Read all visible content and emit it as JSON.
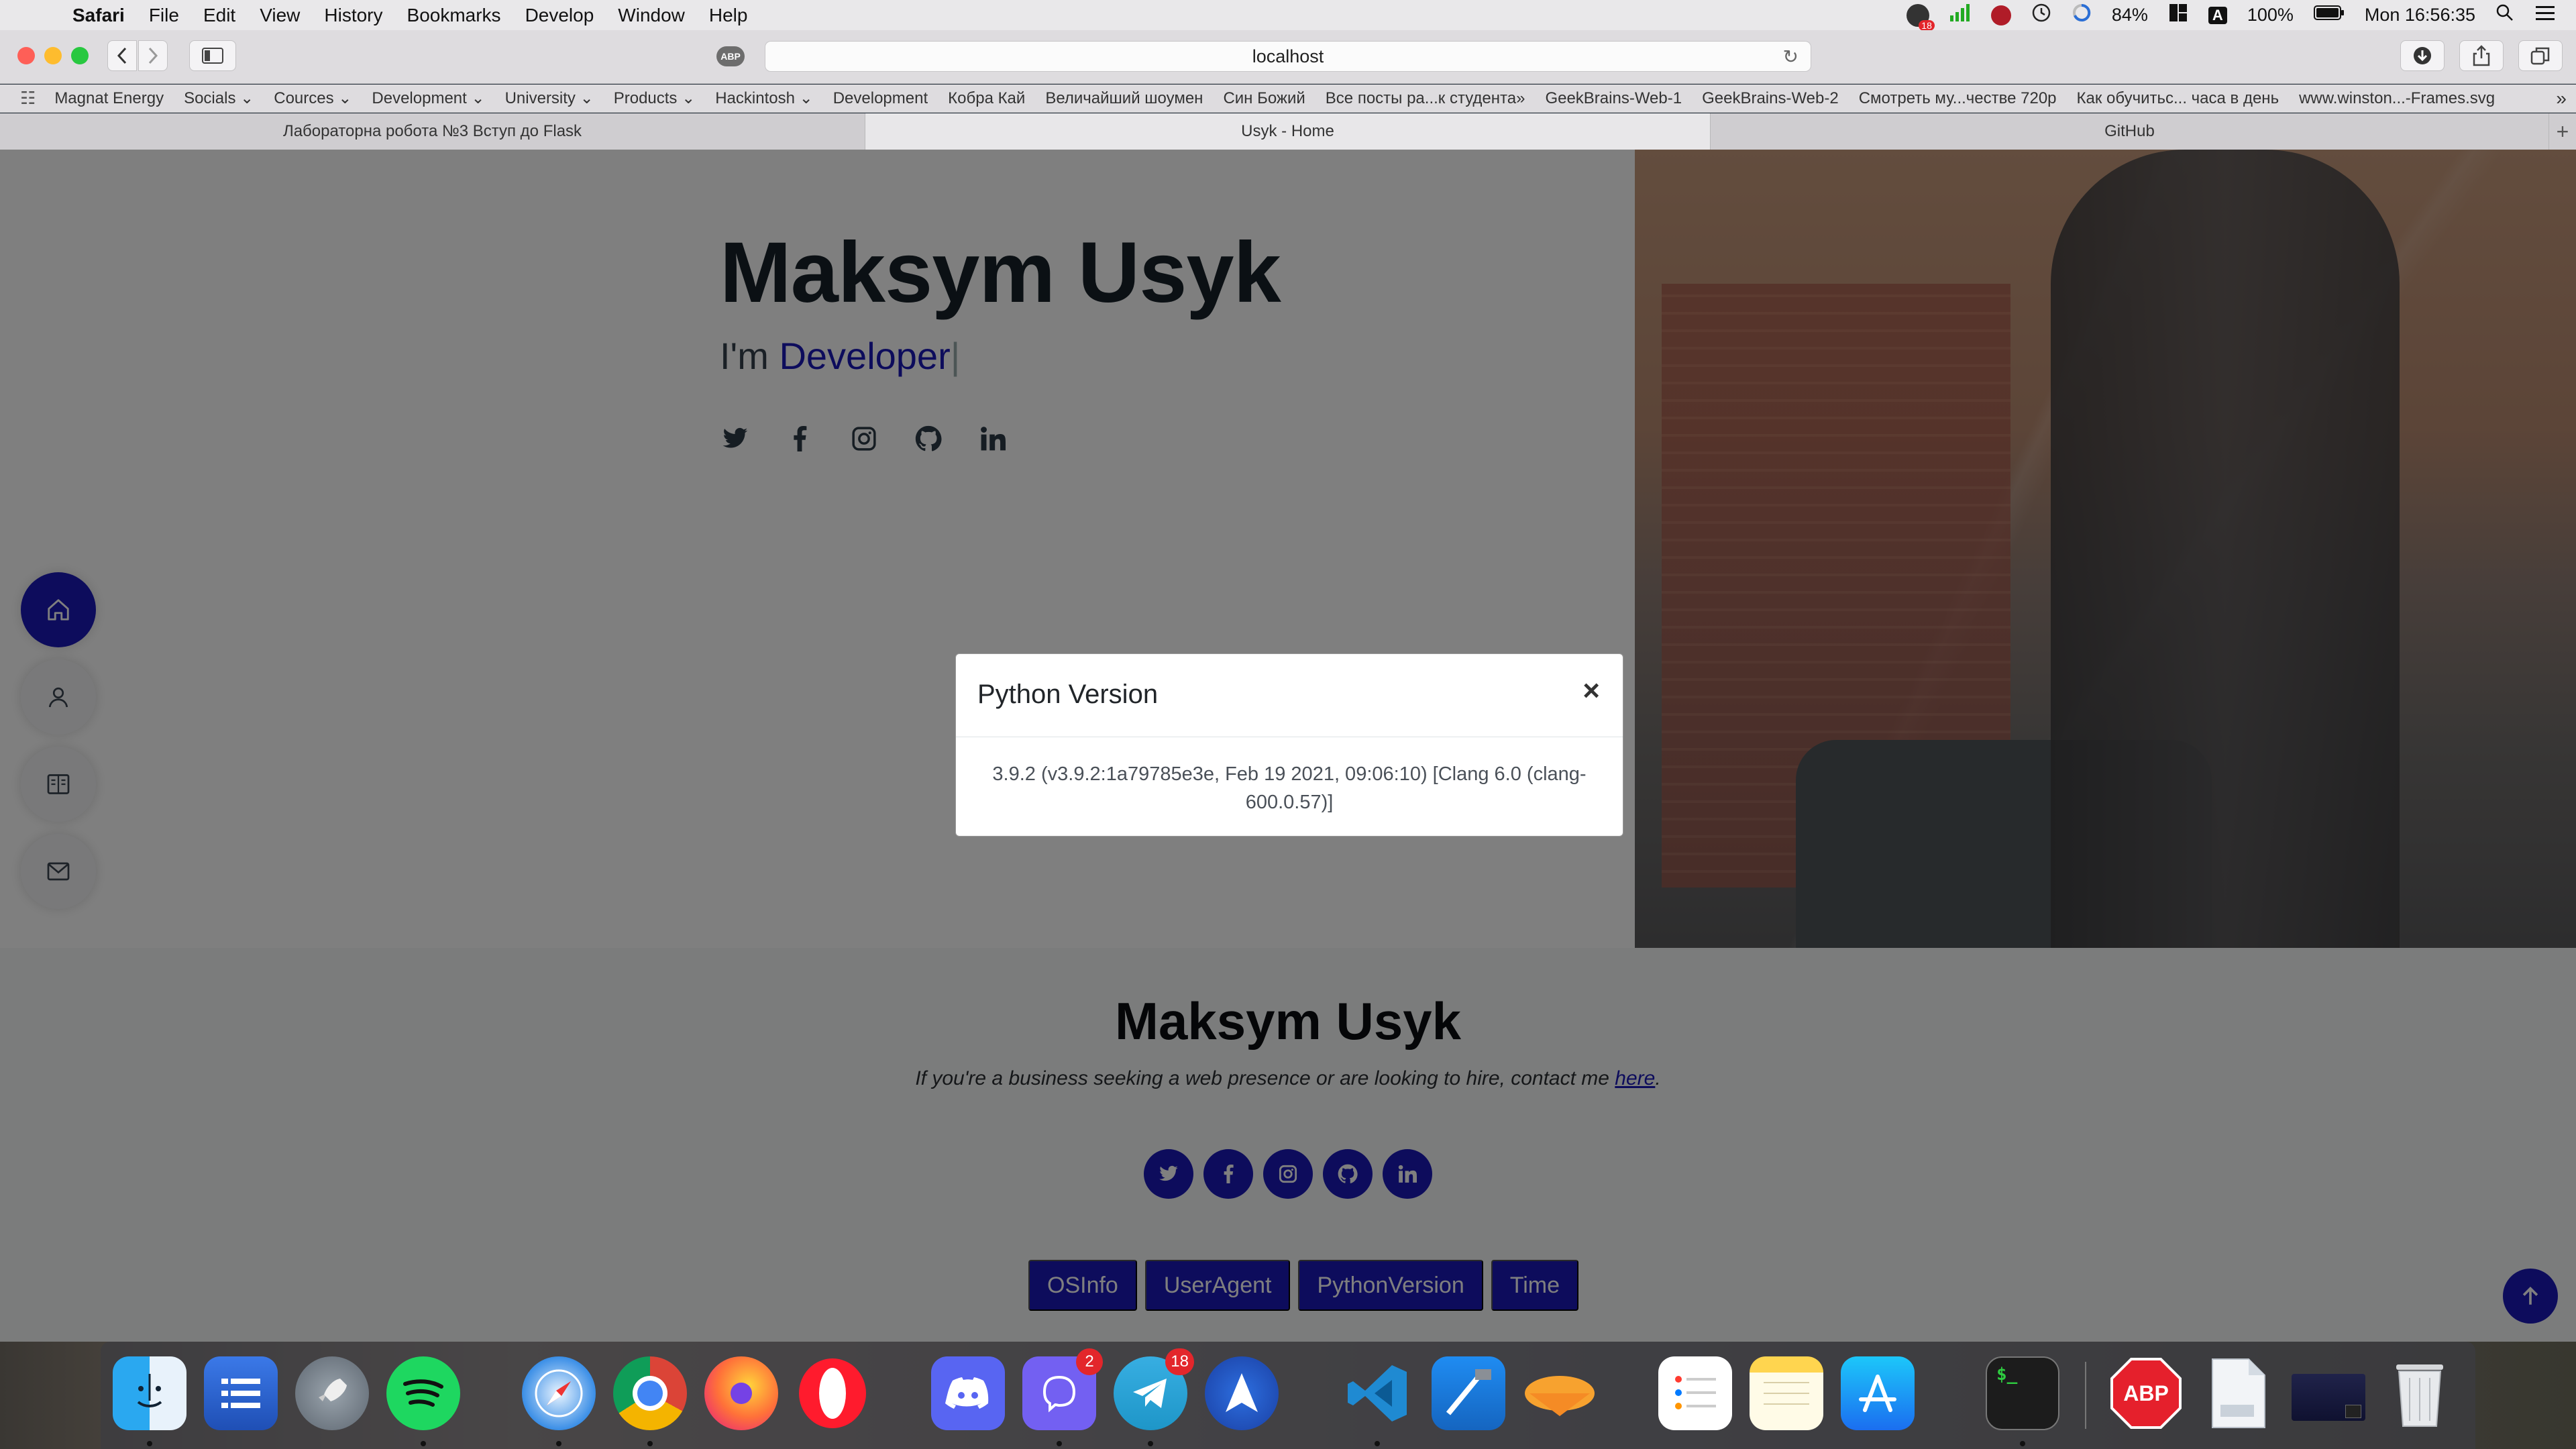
{
  "menubar": {
    "app": "Safari",
    "items": [
      "File",
      "Edit",
      "View",
      "History",
      "Bookmarks",
      "Develop",
      "Window",
      "Help"
    ],
    "battery_percent_small": "84%",
    "battery_percent": "100%",
    "input_source": "A",
    "clock": "Mon 16:56:35",
    "notification_badge": "18"
  },
  "toolbar": {
    "address": "localhost",
    "abp_label": "ABP"
  },
  "favorites": [
    "Magnat Energy",
    "Socials ⌄",
    "Cources ⌄",
    "Development ⌄",
    "University ⌄",
    "Products ⌄",
    "Hackintosh ⌄",
    "Development",
    "Кобра Кай",
    "Величайший шоумен",
    "Син Божий",
    "Все посты ра...к студента»",
    "GeekBrains-Web-1",
    "GeekBrains-Web-2",
    "Смотреть му...честве 720p",
    "Как обучитьс... часа в день",
    "www.winston...-Frames.svg"
  ],
  "tabs": [
    {
      "label": "Лабораторна робота №3 Вступ до Flask"
    },
    {
      "label": "Usyk - Home"
    },
    {
      "label": "GitHub"
    }
  ],
  "hero": {
    "title": "Maksym Usyk",
    "prefix": "I'm ",
    "typed": "Developer",
    "cursor": "|",
    "social_icons": [
      "twitter-icon",
      "facebook-icon",
      "instagram-icon",
      "github-icon",
      "linkedin-icon"
    ]
  },
  "sidenav": [
    "home-icon",
    "user-icon",
    "book-icon",
    "mail-icon"
  ],
  "footer": {
    "title": "Maksym Usyk",
    "text_before": "If you're a business seeking a web presence or are looking to hire, contact me ",
    "link": "here",
    "text_after": ".",
    "buttons": [
      "OSInfo",
      "UserAgent",
      "PythonVersion",
      "Time"
    ]
  },
  "modal": {
    "title": "Python Version",
    "close": "×",
    "body": "3.9.2 (v3.9.2:1a79785e3e, Feb 19 2021, 09:06:10) [Clang 6.0 (clang-600.0.57)]"
  },
  "dock": {
    "viber_badge": "2",
    "telegram_badge": "18",
    "abp_label": "ABP"
  },
  "colors": {
    "accent": "#1a18b9",
    "dark_text": "#172128",
    "overlay": "rgba(0,0,0,0.5)"
  }
}
